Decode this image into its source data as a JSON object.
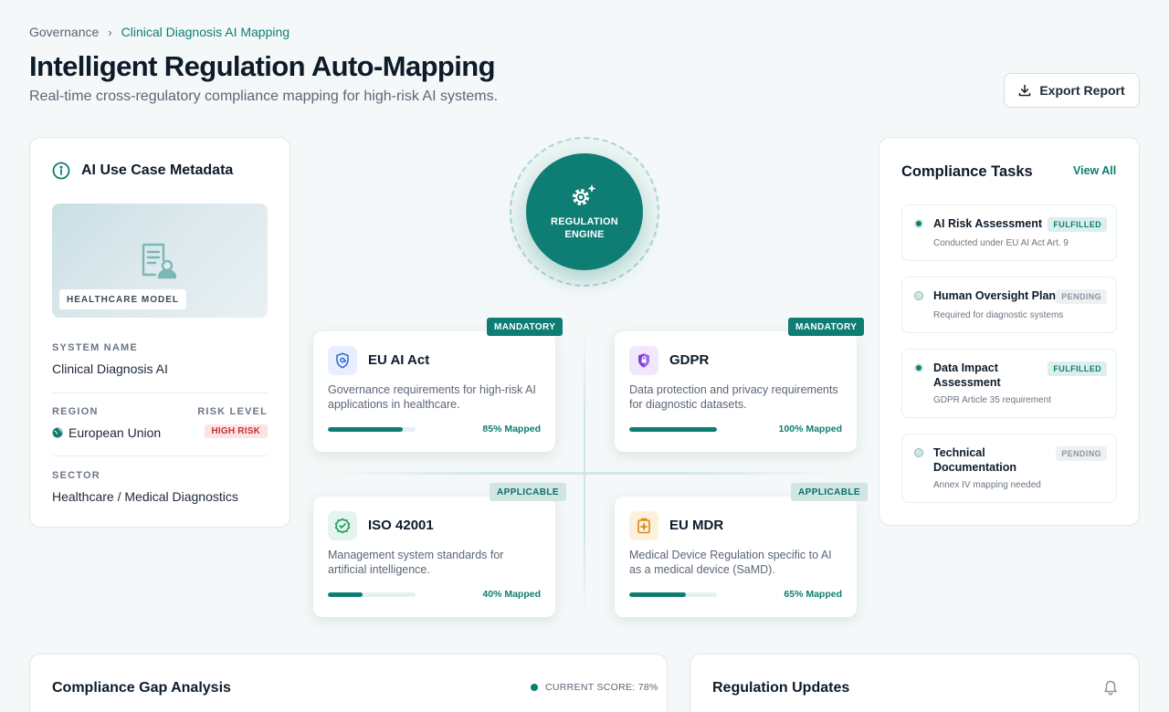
{
  "breadcrumb": {
    "root": "Governance",
    "separator": "›",
    "current": "Clinical Diagnosis AI Mapping"
  },
  "header": {
    "title": "Intelligent Regulation Auto-Mapping",
    "subtitle": "Real-time cross-regulatory compliance mapping for high-risk AI systems.",
    "export_label": "Export Report"
  },
  "metadata": {
    "title": "AI Use Case Metadata",
    "image_tag": "HEALTHCARE MODEL",
    "system_name_label": "SYSTEM NAME",
    "system_name": "Clinical Diagnosis AI",
    "region_label": "REGION",
    "region": "European Union",
    "risk_label": "RISK LEVEL",
    "risk": "HIGH RISK",
    "sector_label": "SECTOR",
    "sector": "Healthcare / Medical Diagnostics"
  },
  "engine": {
    "line1": "REGULATION",
    "line2": "ENGINE"
  },
  "regulations": [
    {
      "badge": "MANDATORY",
      "title": "EU AI Act",
      "desc": "Governance requirements for high-risk AI applications in healthcare.",
      "progress": 85,
      "pct_label": "85% Mapped"
    },
    {
      "badge": "MANDATORY",
      "title": "GDPR",
      "desc": "Data protection and privacy requirements for diagnostic datasets.",
      "progress": 100,
      "pct_label": "100% Mapped"
    },
    {
      "badge": "APPLICABLE",
      "title": "ISO 42001",
      "desc": "Management system standards for artificial intelligence.",
      "progress": 40,
      "pct_label": "40% Mapped"
    },
    {
      "badge": "APPLICABLE",
      "title": "EU MDR",
      "desc": "Medical Device Regulation specific to AI as a medical device (SaMD).",
      "progress": 65,
      "pct_label": "65% Mapped"
    }
  ],
  "tasks": {
    "title": "Compliance Tasks",
    "view_all": "View All",
    "items": [
      {
        "title": "AI Risk Assessment",
        "status": "FULFILLED",
        "sub": "Conducted under EU AI Act Art. 9"
      },
      {
        "title": "Human Oversight Plan",
        "status": "PENDING",
        "sub": "Required for diagnostic systems"
      },
      {
        "title": "Data Impact Assessment",
        "status": "FULFILLED",
        "sub": "GDPR Article 35 requirement"
      },
      {
        "title": "Technical Documentation",
        "status": "PENDING",
        "sub": "Annex IV mapping needed"
      }
    ]
  },
  "gap": {
    "title": "Compliance Gap Analysis",
    "score": "CURRENT SCORE: 78%"
  },
  "updates": {
    "title": "Regulation Updates"
  },
  "colors": {
    "accent": "#0e7d73",
    "accent_light": "#cfe6e3",
    "risk": "#c43434"
  }
}
